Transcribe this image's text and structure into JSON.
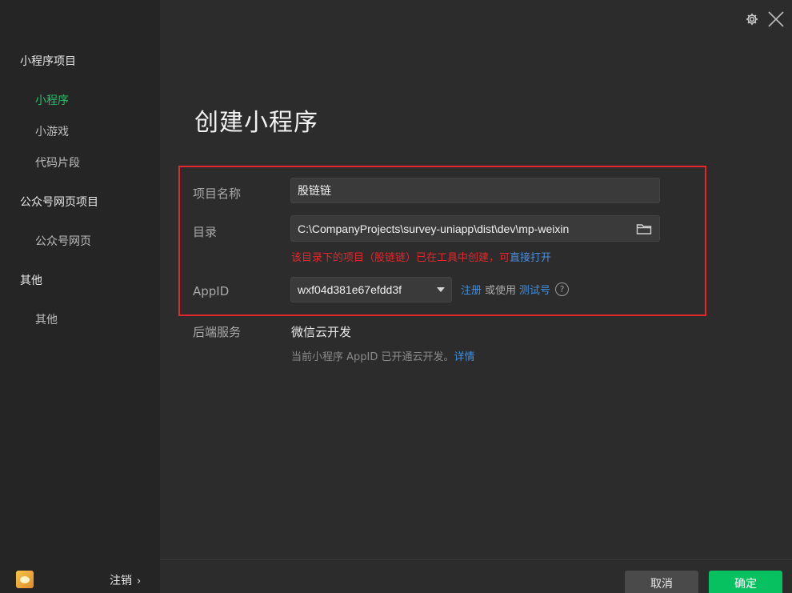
{
  "sidebar": {
    "sections": [
      {
        "label": "小程序项目",
        "items": [
          {
            "label": "小程序"
          },
          {
            "label": "小游戏"
          },
          {
            "label": "代码片段"
          }
        ]
      },
      {
        "label": "公众号网页项目",
        "items": [
          {
            "label": "公众号网页"
          }
        ]
      },
      {
        "label": "其他",
        "items": [
          {
            "label": "其他"
          }
        ]
      }
    ],
    "logout_label": "注销",
    "logout_chevron": "›"
  },
  "main": {
    "title": "创建小程序",
    "form": {
      "project_name_label": "项目名称",
      "project_name_value": "股链链",
      "directory_label": "目录",
      "directory_value": "C:\\CompanyProjects\\survey-uniapp\\dist\\dev\\mp-weixin",
      "warning_text": "该目录下的项目（股链链）已在工具中创建，可",
      "warning_link": "直接打开",
      "appid_label": "AppID",
      "appid_value": "wxf04d381e67efdd3f",
      "register_link": "注册",
      "or_use_text": "或使用",
      "test_id_link": "测试号",
      "help_glyph": "?",
      "backend_label": "后端服务",
      "backend_value": "微信云开发",
      "backend_desc": "当前小程序 AppID 已开通云开发。",
      "backend_detail_link": "详情"
    },
    "buttons": {
      "cancel": "取消",
      "confirm": "确定"
    }
  },
  "colors": {
    "active": "#23c06a",
    "warning": "#e3272d",
    "link": "#3f8fe0",
    "confirm": "#07c160"
  },
  "icons": [
    "gear-icon",
    "close-icon",
    "folder-icon",
    "caret-down-icon",
    "help-icon",
    "avatar"
  ]
}
